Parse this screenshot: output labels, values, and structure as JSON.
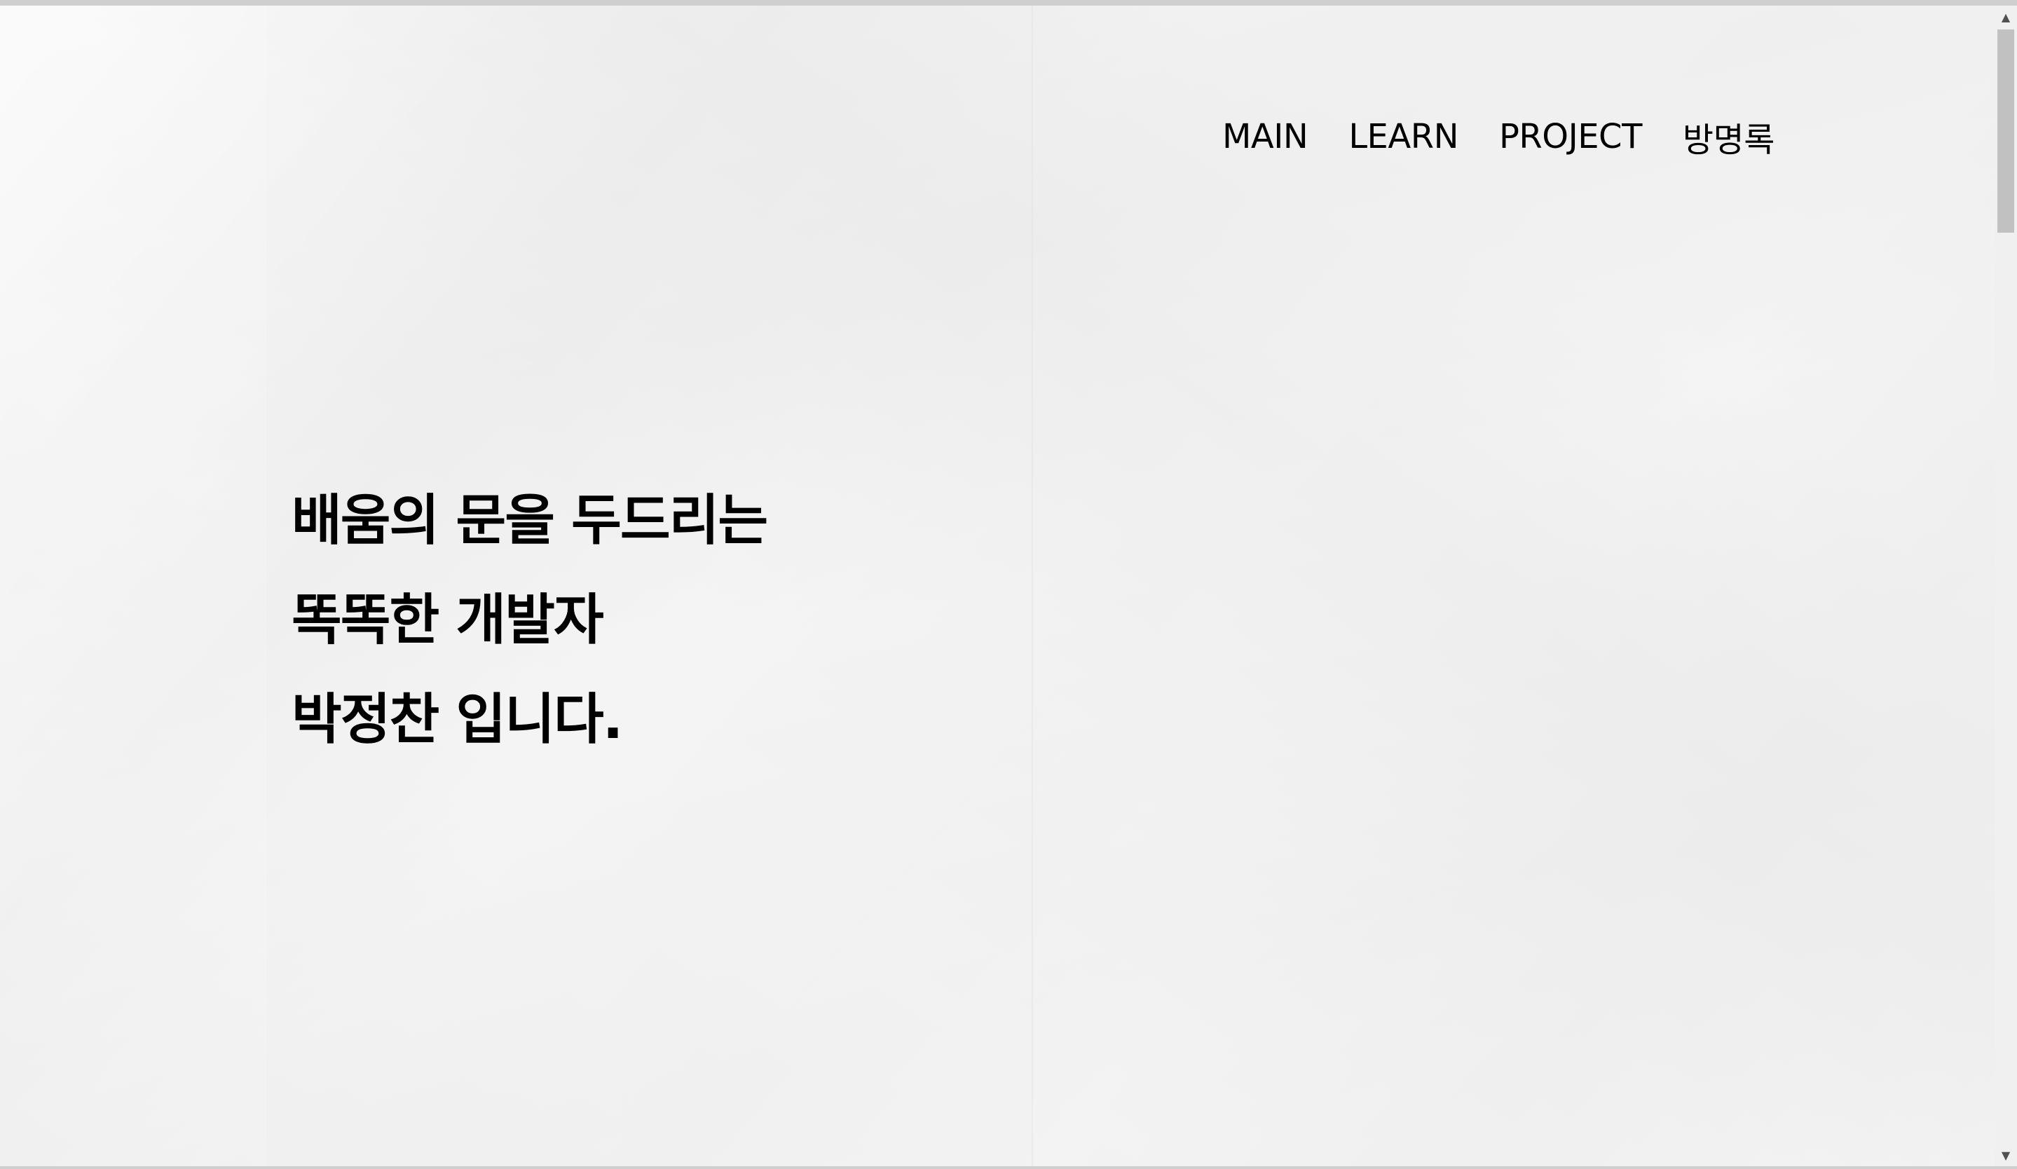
{
  "nav": {
    "items": [
      {
        "label": "MAIN"
      },
      {
        "label": "LEARN"
      },
      {
        "label": "PROJECT"
      },
      {
        "label": "방명록"
      }
    ]
  },
  "hero": {
    "lines": [
      "배움의 문을 두드리는",
      "똑똑한 개발자",
      "박정찬 입니다."
    ]
  },
  "scrollbar": {
    "up_icon": "▲",
    "down_icon": "▼"
  }
}
